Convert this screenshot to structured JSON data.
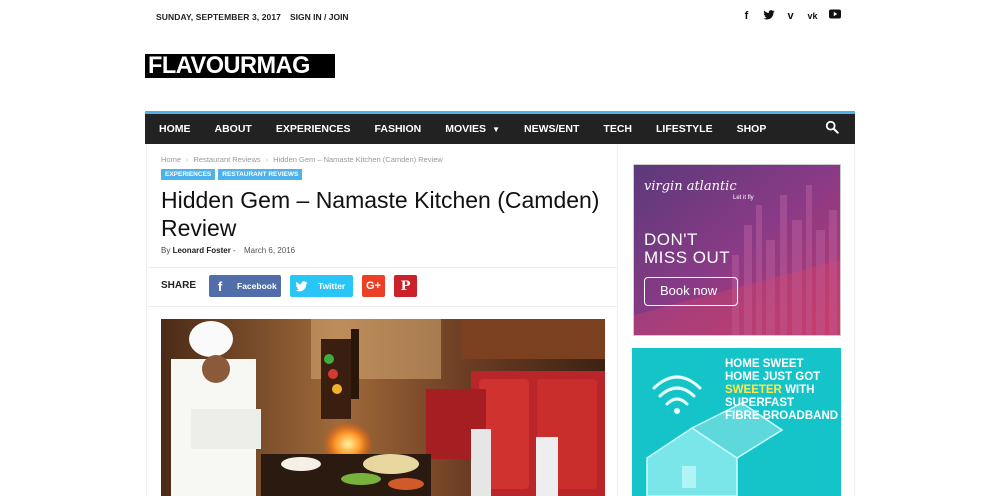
{
  "topbar": {
    "date": "SUNDAY, SEPTEMBER 3, 2017",
    "signin": "SIGN IN / JOIN",
    "socials": [
      "facebook-icon",
      "twitter-icon",
      "vimeo-icon",
      "vk-icon",
      "youtube-icon"
    ],
    "social_glyphs": [
      "f",
      "t",
      "v",
      "vk",
      "▶"
    ]
  },
  "logo": {
    "text": "FLAVOURMAG"
  },
  "nav": {
    "items": [
      {
        "label": "HOME"
      },
      {
        "label": "ABOUT"
      },
      {
        "label": "EXPERIENCES"
      },
      {
        "label": "FASHION"
      },
      {
        "label": "MOVIES"
      },
      {
        "label": "NEWS/ENT"
      },
      {
        "label": "TECH"
      },
      {
        "label": "LIFESTYLE"
      },
      {
        "label": "SHOP"
      }
    ],
    "accent": "#4db2ec"
  },
  "article": {
    "breadcrumb": [
      "Home",
      "Restaurant Reviews",
      "Hidden Gem – Namaste Kitchen (Camden) Review"
    ],
    "tags": [
      "EXPERIENCES",
      "RESTAURANT REVIEWS"
    ],
    "title": "Hidden Gem – Namaste Kitchen (Camden) Review",
    "byline_prefix": "By",
    "author": "Leonard Foster",
    "author_sep": "-",
    "date": "March 6, 2016",
    "share": {
      "label": "SHARE",
      "facebook": "Facebook",
      "twitter": "Twitter"
    }
  },
  "ads": {
    "virgin": {
      "brand": "virgin atlantic",
      "tagline": "Let it fly",
      "headline1": "DON'T",
      "headline2": "MISS OUT",
      "cta": "Book now"
    },
    "broadband": {
      "line1": "HOME SWEET",
      "line2": "HOME JUST GOT",
      "line3a": "SWEETER",
      "line3b": " WITH",
      "line4": "SUPERFAST",
      "line5": "FIBRE BROADBAND"
    }
  }
}
